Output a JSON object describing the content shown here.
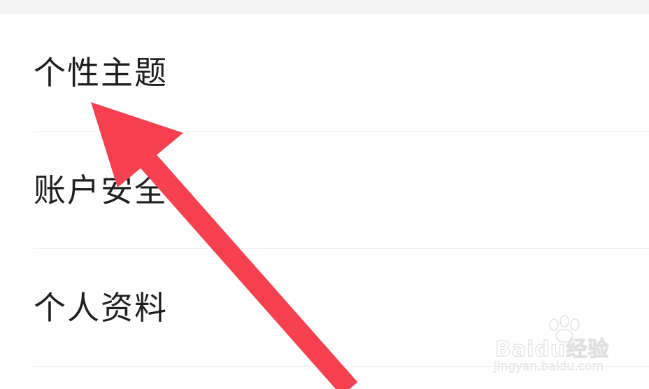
{
  "menu": {
    "items": [
      {
        "label": "个性主题"
      },
      {
        "label": "账户安全"
      },
      {
        "label": "个人资料"
      }
    ]
  },
  "annotation": {
    "arrow_color": "#f6404f",
    "icon": "arrow-pointing-up-left"
  },
  "watermark": {
    "brand": "Baidu经验",
    "url": "jingyan.baidu.com"
  }
}
